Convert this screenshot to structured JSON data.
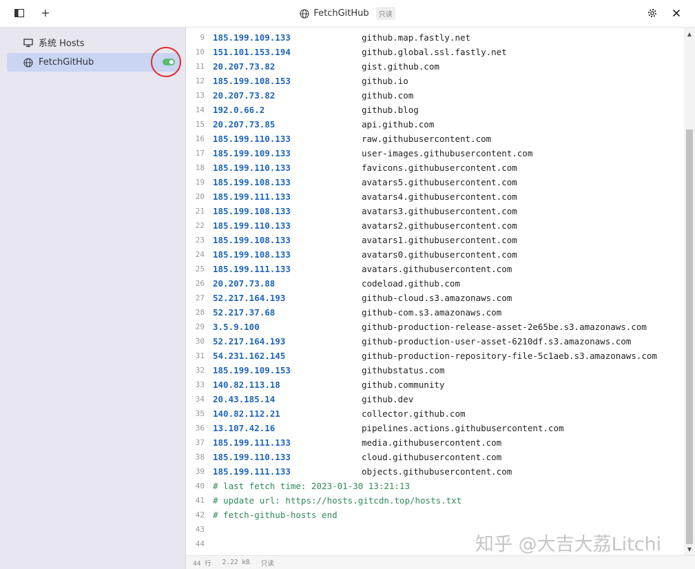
{
  "window": {
    "title": "FetchGitHub",
    "readonly_badge": "只读"
  },
  "sidebar": {
    "items": [
      {
        "label": "系统 Hosts",
        "icon": "monitor-icon",
        "active": false
      },
      {
        "label": "FetchGitHub",
        "icon": "globe-icon",
        "active": true,
        "enabled": true
      }
    ]
  },
  "editor": {
    "lines": [
      {
        "n": "9",
        "ip": "185.199.109.133",
        "host": "github.map.fastly.net"
      },
      {
        "n": "10",
        "ip": "151.101.153.194",
        "host": "github.global.ssl.fastly.net"
      },
      {
        "n": "11",
        "ip": "20.207.73.82",
        "host": "gist.github.com"
      },
      {
        "n": "12",
        "ip": "185.199.108.153",
        "host": "github.io"
      },
      {
        "n": "13",
        "ip": "20.207.73.82",
        "host": "github.com"
      },
      {
        "n": "14",
        "ip": "192.0.66.2",
        "host": "github.blog"
      },
      {
        "n": "15",
        "ip": "20.207.73.85",
        "host": "api.github.com"
      },
      {
        "n": "16",
        "ip": "185.199.110.133",
        "host": "raw.githubusercontent.com"
      },
      {
        "n": "17",
        "ip": "185.199.109.133",
        "host": "user-images.githubusercontent.com"
      },
      {
        "n": "18",
        "ip": "185.199.110.133",
        "host": "favicons.githubusercontent.com"
      },
      {
        "n": "19",
        "ip": "185.199.108.133",
        "host": "avatars5.githubusercontent.com"
      },
      {
        "n": "20",
        "ip": "185.199.111.133",
        "host": "avatars4.githubusercontent.com"
      },
      {
        "n": "21",
        "ip": "185.199.108.133",
        "host": "avatars3.githubusercontent.com"
      },
      {
        "n": "22",
        "ip": "185.199.110.133",
        "host": "avatars2.githubusercontent.com"
      },
      {
        "n": "23",
        "ip": "185.199.108.133",
        "host": "avatars1.githubusercontent.com"
      },
      {
        "n": "24",
        "ip": "185.199.108.133",
        "host": "avatars0.githubusercontent.com"
      },
      {
        "n": "25",
        "ip": "185.199.111.133",
        "host": "avatars.githubusercontent.com"
      },
      {
        "n": "26",
        "ip": "20.207.73.88",
        "host": "codeload.github.com"
      },
      {
        "n": "27",
        "ip": "52.217.164.193",
        "host": "github-cloud.s3.amazonaws.com"
      },
      {
        "n": "28",
        "ip": "52.217.37.68",
        "host": "github-com.s3.amazonaws.com"
      },
      {
        "n": "29",
        "ip": "3.5.9.100",
        "host": "github-production-release-asset-2e65be.s3.amazonaws.com"
      },
      {
        "n": "30",
        "ip": "52.217.164.193",
        "host": "github-production-user-asset-6210df.s3.amazonaws.com"
      },
      {
        "n": "31",
        "ip": "54.231.162.145",
        "host": "github-production-repository-file-5c1aeb.s3.amazonaws.com"
      },
      {
        "n": "32",
        "ip": "185.199.109.153",
        "host": "githubstatus.com"
      },
      {
        "n": "33",
        "ip": "140.82.113.18",
        "host": "github.community"
      },
      {
        "n": "34",
        "ip": "20.43.185.14",
        "host": "github.dev"
      },
      {
        "n": "35",
        "ip": "140.82.112.21",
        "host": "collector.github.com"
      },
      {
        "n": "36",
        "ip": "13.107.42.16",
        "host": "pipelines.actions.githubusercontent.com"
      },
      {
        "n": "37",
        "ip": "185.199.111.133",
        "host": "media.githubusercontent.com"
      },
      {
        "n": "38",
        "ip": "185.199.110.133",
        "host": "cloud.githubusercontent.com"
      },
      {
        "n": "39",
        "ip": "185.199.111.133",
        "host": "objects.githubusercontent.com"
      },
      {
        "n": "40",
        "comment": "# last fetch time: 2023-01-30 13:21:13"
      },
      {
        "n": "41",
        "comment": "# update url: https://hosts.gitcdn.top/hosts.txt"
      },
      {
        "n": "42",
        "comment": "# fetch-github-hosts end"
      },
      {
        "n": "43"
      },
      {
        "n": "44"
      }
    ]
  },
  "statusbar": {
    "lines": "44 行",
    "size": "2.22 kB",
    "mode": "只读"
  },
  "watermark": "知乎 @大吉大荔Litchi",
  "colors": {
    "ip": "#1d64b9",
    "comment": "#2e8b57",
    "sidebar_bg": "#e8e6ef",
    "active_item": "#c9d5f3",
    "toggle_on": "#5bbd72",
    "highlight_circle": "#e02b2b"
  }
}
